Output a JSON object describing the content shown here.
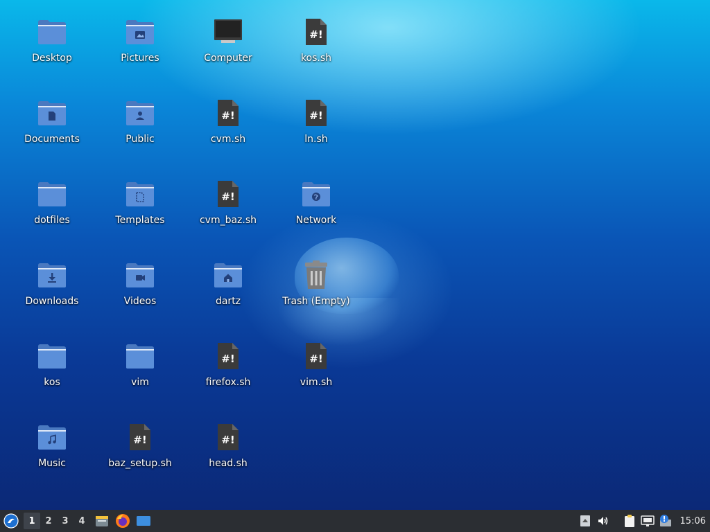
{
  "desktop": {
    "icons": [
      {
        "label": "Desktop",
        "type": "folder",
        "glyph": "none"
      },
      {
        "label": "Pictures",
        "type": "folder",
        "glyph": "image"
      },
      {
        "label": "Computer",
        "type": "computer"
      },
      {
        "label": "kos.sh",
        "type": "script"
      },
      {
        "label": "Documents",
        "type": "folder",
        "glyph": "doc"
      },
      {
        "label": "Public",
        "type": "folder",
        "glyph": "person"
      },
      {
        "label": "cvm.sh",
        "type": "script"
      },
      {
        "label": "ln.sh",
        "type": "script"
      },
      {
        "label": "dotfiles",
        "type": "folder",
        "glyph": "none"
      },
      {
        "label": "Templates",
        "type": "folder",
        "glyph": "template"
      },
      {
        "label": "cvm_baz.sh",
        "type": "script"
      },
      {
        "label": "Network",
        "type": "folder",
        "glyph": "globe"
      },
      {
        "label": "Downloads",
        "type": "folder",
        "glyph": "download"
      },
      {
        "label": "Videos",
        "type": "folder",
        "glyph": "video"
      },
      {
        "label": "dartz",
        "type": "folder",
        "glyph": "home"
      },
      {
        "label": "Trash (Empty)",
        "type": "trash"
      },
      {
        "label": "kos",
        "type": "folder",
        "glyph": "none"
      },
      {
        "label": "vim",
        "type": "folder",
        "glyph": "none"
      },
      {
        "label": "firefox.sh",
        "type": "script"
      },
      {
        "label": "vim.sh",
        "type": "script"
      },
      {
        "label": "Music",
        "type": "folder",
        "glyph": "music"
      },
      {
        "label": "baz_setup.sh",
        "type": "script"
      },
      {
        "label": "head.sh",
        "type": "script"
      }
    ]
  },
  "taskbar": {
    "start_icon": "lubuntu-logo-icon",
    "workspaces": [
      "1",
      "2",
      "3",
      "4"
    ],
    "active_workspace": "1",
    "apps": [
      "file-manager-icon",
      "firefox-icon",
      "show-desktop-icon"
    ],
    "tray": [
      "tray-arrow-icon",
      "volume-icon",
      "clipboard-icon",
      "network-icon",
      "update-notifier-icon"
    ],
    "clock": "15:06"
  },
  "colors": {
    "folder": "#5b8fd9",
    "folder_tab": "#4a79c0",
    "script": "#3b3b3b",
    "taskbar": "#2b2e33"
  }
}
